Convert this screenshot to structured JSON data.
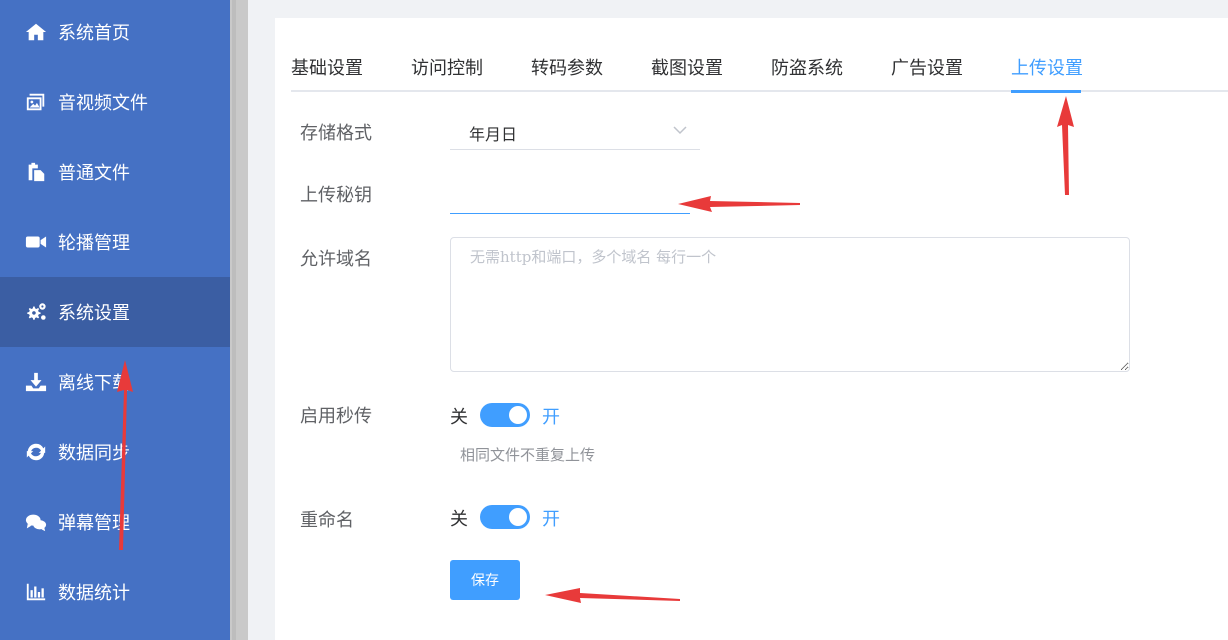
{
  "sidebar": {
    "items": [
      {
        "label": "系统首页",
        "icon": "home-icon"
      },
      {
        "label": "音视频文件",
        "icon": "media-icon"
      },
      {
        "label": "普通文件",
        "icon": "file-icon"
      },
      {
        "label": "轮播管理",
        "icon": "video-camera-icon"
      },
      {
        "label": "系统设置",
        "icon": "gears-icon",
        "active": true
      },
      {
        "label": "离线下载",
        "icon": "download-icon"
      },
      {
        "label": "数据同步",
        "icon": "sync-icon"
      },
      {
        "label": "弹幕管理",
        "icon": "comments-icon"
      },
      {
        "label": "数据统计",
        "icon": "chart-icon"
      }
    ]
  },
  "tabs": [
    {
      "label": "基础设置"
    },
    {
      "label": "访问控制"
    },
    {
      "label": "转码参数"
    },
    {
      "label": "截图设置"
    },
    {
      "label": "防盗系统"
    },
    {
      "label": "广告设置"
    },
    {
      "label": "上传设置",
      "active": true
    }
  ],
  "form": {
    "storage_format": {
      "label": "存储格式",
      "value": "年月日"
    },
    "upload_key": {
      "label": "上传秘钥",
      "value": ""
    },
    "allowed_domains": {
      "label": "允许域名",
      "placeholder": "无需http和端口，多个域名 每行一个"
    },
    "instant_upload": {
      "label": "启用秒传",
      "off_label": "关",
      "on_label": "开",
      "on": true,
      "hint": "相同文件不重复上传"
    },
    "rename": {
      "label": "重命名",
      "off_label": "关",
      "on_label": "开",
      "on": true
    },
    "save_label": "保存"
  },
  "colors": {
    "sidebar_bg": "#4571c4",
    "sidebar_active": "#3b5ea3",
    "accent": "#409eff",
    "arrow": "#e83a3a"
  }
}
